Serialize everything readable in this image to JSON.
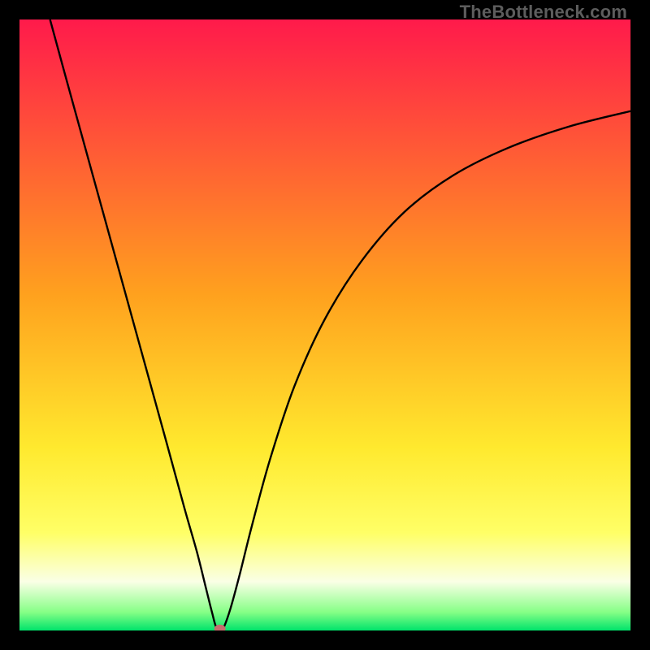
{
  "watermark": "TheBottleneck.com",
  "chart_data": {
    "type": "line",
    "title": "",
    "xlabel": "",
    "ylabel": "",
    "xlim": [
      0,
      100
    ],
    "ylim": [
      0,
      100
    ],
    "grid": false,
    "legend": false,
    "background_gradient": {
      "stops": [
        {
          "offset": 0.0,
          "color": "#ff1a4b"
        },
        {
          "offset": 0.45,
          "color": "#ffa11e"
        },
        {
          "offset": 0.7,
          "color": "#ffe92e"
        },
        {
          "offset": 0.84,
          "color": "#ffff66"
        },
        {
          "offset": 0.92,
          "color": "#faffe6"
        },
        {
          "offset": 0.97,
          "color": "#86ff86"
        },
        {
          "offset": 1.0,
          "color": "#00e36b"
        }
      ]
    },
    "series": [
      {
        "name": "bottleneck-curve",
        "color": "#000000",
        "points": [
          {
            "x": 5.0,
            "y": 100.0
          },
          {
            "x": 8.0,
            "y": 89.0
          },
          {
            "x": 12.0,
            "y": 74.5
          },
          {
            "x": 16.0,
            "y": 60.0
          },
          {
            "x": 20.0,
            "y": 45.5
          },
          {
            "x": 24.0,
            "y": 31.0
          },
          {
            "x": 27.0,
            "y": 20.0
          },
          {
            "x": 29.0,
            "y": 13.0
          },
          {
            "x": 30.5,
            "y": 7.0
          },
          {
            "x": 31.5,
            "y": 3.0
          },
          {
            "x": 32.3,
            "y": 0.3
          },
          {
            "x": 33.3,
            "y": 0.3
          },
          {
            "x": 34.5,
            "y": 3.5
          },
          {
            "x": 36.0,
            "y": 9.0
          },
          {
            "x": 38.0,
            "y": 17.0
          },
          {
            "x": 41.0,
            "y": 28.0
          },
          {
            "x": 45.0,
            "y": 40.0
          },
          {
            "x": 50.0,
            "y": 51.0
          },
          {
            "x": 56.0,
            "y": 60.5
          },
          {
            "x": 63.0,
            "y": 68.5
          },
          {
            "x": 71.0,
            "y": 74.5
          },
          {
            "x": 80.0,
            "y": 79.0
          },
          {
            "x": 90.0,
            "y": 82.5
          },
          {
            "x": 100.0,
            "y": 85.0
          }
        ]
      }
    ],
    "marker": {
      "x": 32.8,
      "y": 0.3,
      "color": "#c56e6e",
      "rx": 7,
      "ry": 5
    }
  }
}
